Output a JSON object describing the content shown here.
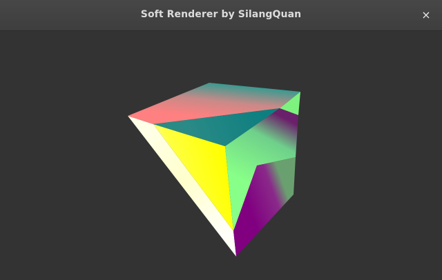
{
  "window": {
    "title": "Soft Renderer by SilangQuan",
    "close_glyph": "×"
  },
  "viewport": {
    "background": "#333333"
  },
  "icons": {
    "close": "close-icon"
  },
  "colors": {
    "yellow": "#ffff00",
    "white": "#ffffff",
    "pink": "#ff8080",
    "teal": "#008080",
    "green": "#80ff80",
    "purple": "#800080"
  }
}
